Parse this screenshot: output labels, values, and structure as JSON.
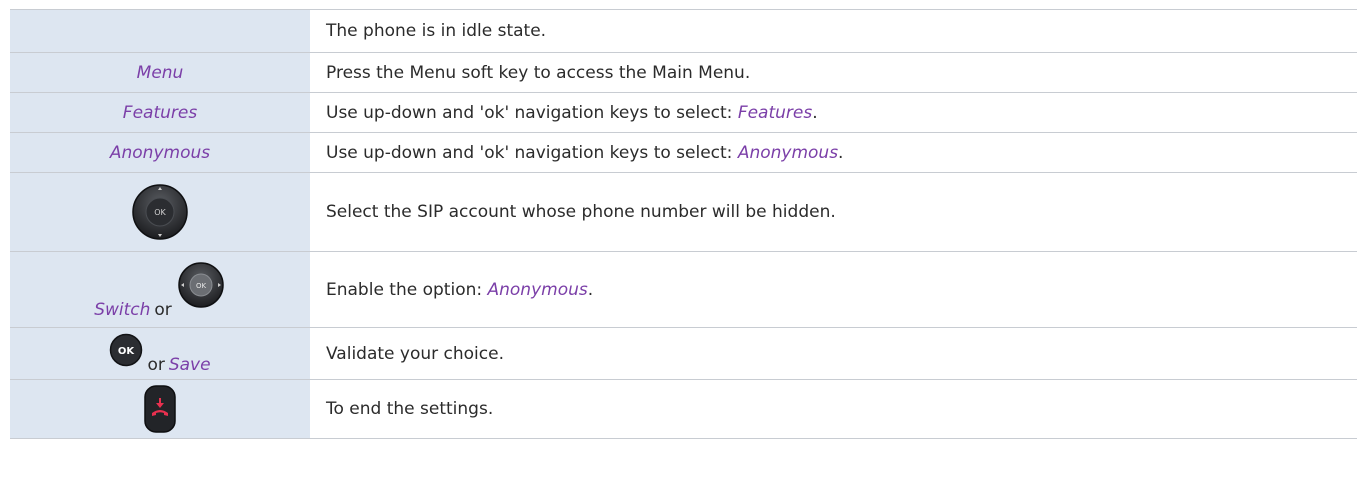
{
  "rows": [
    {
      "key": "",
      "text": "The phone is in idle state."
    },
    {
      "key": "Menu",
      "text": "Press the Menu soft key to access the Main Menu."
    },
    {
      "key": "Features",
      "text_before": "Use up-down and 'ok' navigation keys to select: ",
      "text_emph": "Features",
      "text_after": "."
    },
    {
      "key": "Anonymous",
      "text_before": "Use up-down and 'ok' navigation keys to select: ",
      "text_emph": "Anonymous",
      "text_after": "."
    },
    {
      "icon": "navigation-pad-up-down-icon",
      "icon_label": "OK",
      "text": "Select the SIP account whose phone number will be hidden."
    },
    {
      "key": "Switch",
      "connector": "or",
      "icon": "navigation-pad-left-right-icon",
      "icon_label": "OK",
      "text_before": "Enable the option: ",
      "text_emph": "Anonymous",
      "text_after": "."
    },
    {
      "icon": "ok-key-icon",
      "icon_label": "OK",
      "connector": "or",
      "key": "Save",
      "text": "Validate your choice."
    },
    {
      "icon": "end-call-key-icon",
      "text": "To end the settings."
    }
  ],
  "colors": {
    "left_column_bg": "#dde6f1",
    "keyword": "#7b3fa8",
    "end_call": "#e8304f"
  }
}
